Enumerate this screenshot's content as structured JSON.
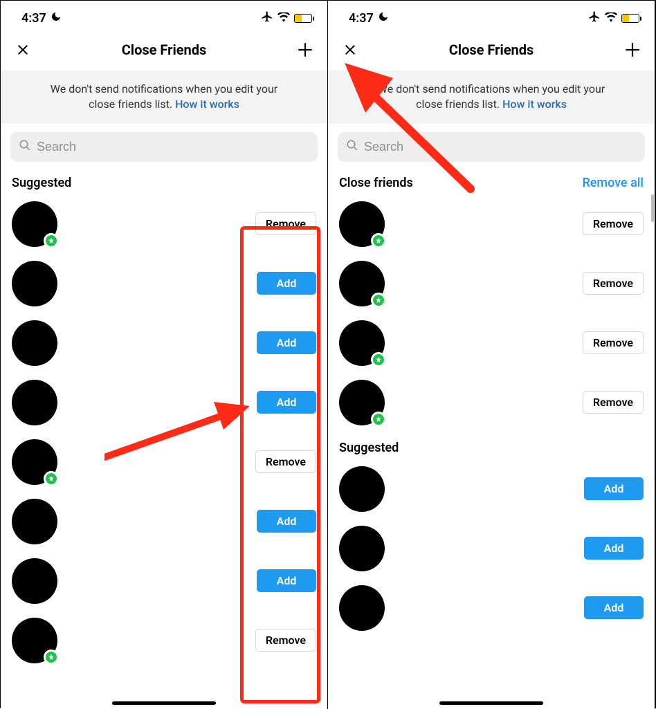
{
  "status": {
    "time": "4:37",
    "moon": "☾"
  },
  "header": {
    "title": "Close Friends"
  },
  "banner": {
    "text_a": "We don't send notifications when you edit your",
    "text_b": "close friends list. ",
    "link": "How it works"
  },
  "search": {
    "placeholder": "Search"
  },
  "buttons": {
    "add": "Add",
    "remove": "Remove",
    "remove_all": "Remove all"
  },
  "left": {
    "section": "Suggested",
    "rows": [
      {
        "badge": true,
        "action": "remove"
      },
      {
        "badge": false,
        "action": "add"
      },
      {
        "badge": false,
        "action": "add"
      },
      {
        "badge": false,
        "action": "add"
      },
      {
        "badge": true,
        "action": "remove"
      },
      {
        "badge": false,
        "action": "add"
      },
      {
        "badge": false,
        "action": "add"
      },
      {
        "badge": true,
        "action": "remove"
      }
    ]
  },
  "right": {
    "section_a": "Close friends",
    "section_b": "Suggested",
    "close_rows": [
      {
        "badge": true,
        "action": "remove"
      },
      {
        "badge": true,
        "action": "remove"
      },
      {
        "badge": true,
        "action": "remove"
      },
      {
        "badge": true,
        "action": "remove"
      }
    ],
    "suggested_rows": [
      {
        "badge": false,
        "action": "add"
      },
      {
        "badge": false,
        "action": "add"
      },
      {
        "badge": false,
        "action": "add"
      }
    ]
  }
}
